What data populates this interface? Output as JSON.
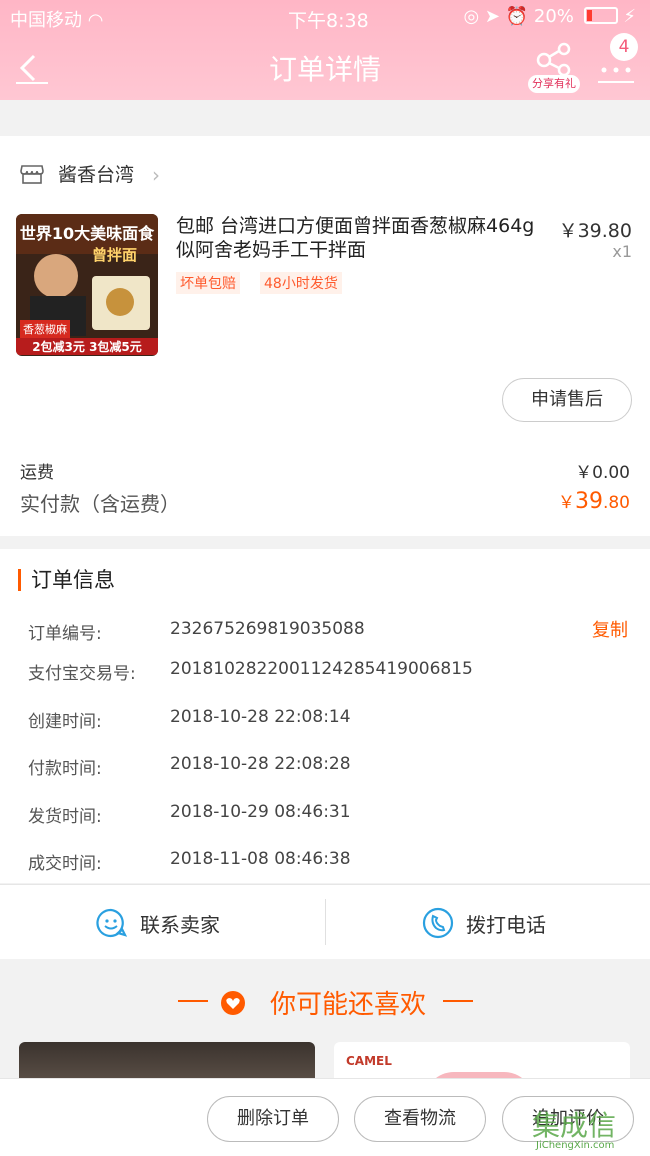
{
  "status": {
    "carrier": "中国移动",
    "time": "下午8:38",
    "battery": "20%"
  },
  "nav": {
    "title": "订单详情",
    "share_label": "分享有礼",
    "badge_count": "4"
  },
  "shop": {
    "name": "酱香台湾"
  },
  "product": {
    "title": "包邮 台湾进口方便面曾拌面香葱椒麻464g 似阿舍老妈手工干拌面",
    "price": "￥39.80",
    "qty": "x1",
    "tags": [
      "坏单包赔",
      "48小时发货"
    ],
    "thumb_top": "世界10大美味面食",
    "thumb_mid": "曾拌面",
    "thumb_tag": "香葱椒麻",
    "thumb_promo": "2包减3元 3包减5元"
  },
  "after_sale_label": "申请售后",
  "fees": {
    "shipping_label": "运费",
    "shipping_value": "￥0.00",
    "paid_label": "实付款（含运费）",
    "paid_currency": "￥",
    "paid_int": "39",
    "paid_dec": ".80"
  },
  "order_info": {
    "title": "订单信息",
    "copy_label": "复制",
    "rows": [
      {
        "label": "订单编号:",
        "value": "232675269819035088"
      },
      {
        "label": "支付宝交易号:",
        "value": "2018102822001124285419006815"
      },
      {
        "label": "创建时间:",
        "value": "2018-10-28 22:08:14"
      },
      {
        "label": "付款时间:",
        "value": "2018-10-28 22:08:28"
      },
      {
        "label": "发货时间:",
        "value": "2018-10-29 08:46:31"
      },
      {
        "label": "成交时间:",
        "value": "2018-11-08 08:46:38"
      }
    ]
  },
  "contact": {
    "seller_label": "联系卖家",
    "call_label": "拨打电话"
  },
  "recommend": {
    "title": "你可能还喜欢",
    "camel_brand": "CAMEL"
  },
  "bottom": {
    "delete_label": "删除订单",
    "logistics_label": "查看物流",
    "review_label": "追加评价"
  },
  "watermark": {
    "main": "集成信",
    "sub": "JiChengXin.com"
  },
  "colors": {
    "header": "#ffbccb",
    "accent": "#ff5a00"
  }
}
